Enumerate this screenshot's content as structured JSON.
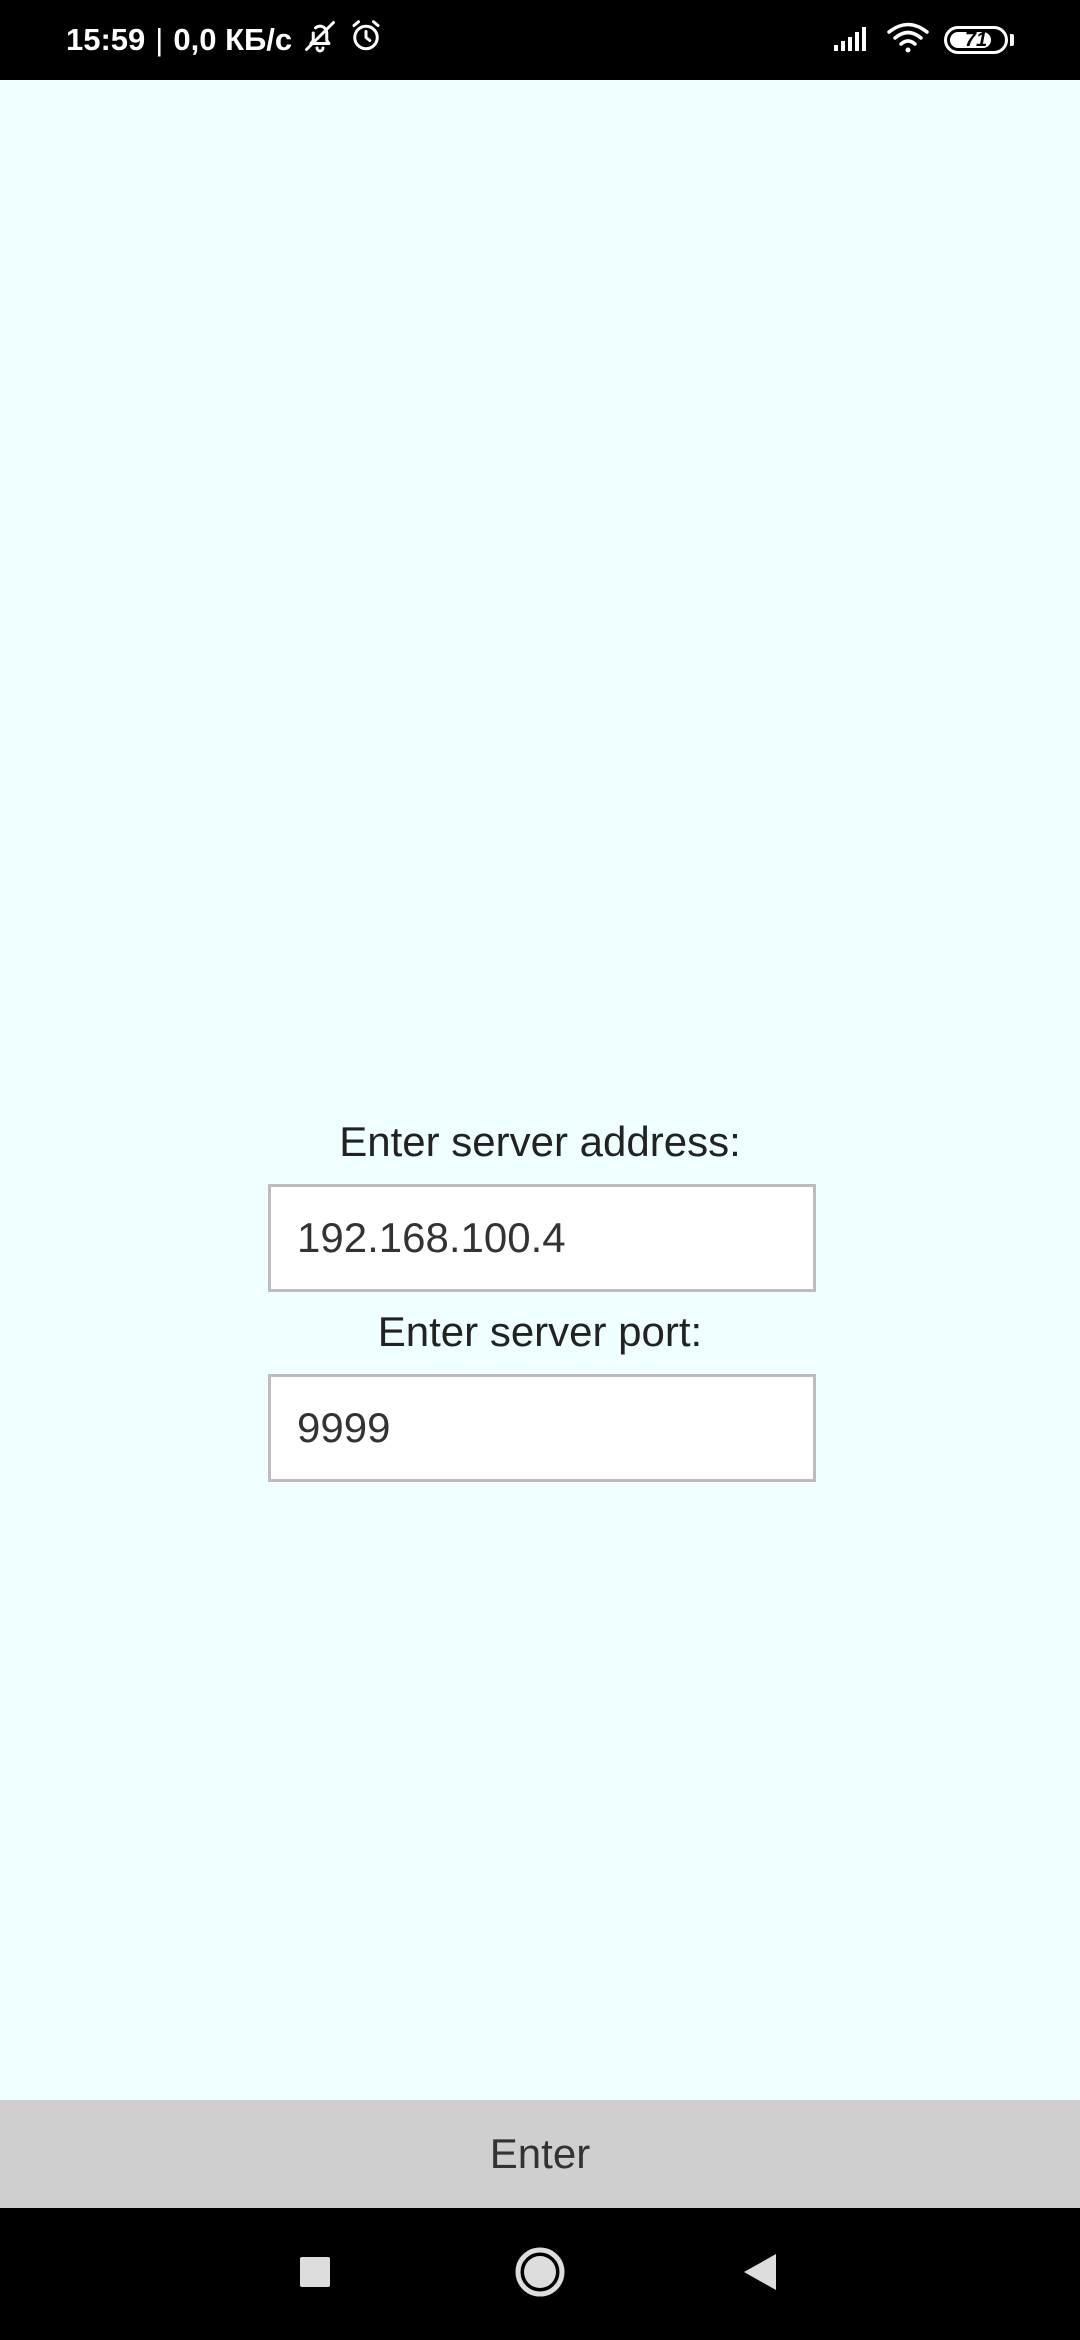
{
  "status_bar": {
    "time": "15:59",
    "separator": "|",
    "network_speed": "0,0 КБ/с",
    "battery_level": "71",
    "icons": [
      "bell-off-icon",
      "alarm-icon",
      "signal-icon",
      "wifi-icon",
      "battery-icon"
    ]
  },
  "form": {
    "address_label": "Enter server address:",
    "address_value": "192.168.100.4",
    "port_label": "Enter server port:",
    "port_value": "9999"
  },
  "enter_button": {
    "label": "Enter"
  },
  "nav_bar": {
    "icons": [
      "recents-icon",
      "home-icon",
      "back-icon"
    ]
  },
  "colors": {
    "background": "#EFFFFF",
    "button_bg": "#CFCFCF",
    "input_border": "#BDBDBD",
    "bars": "#000000"
  }
}
